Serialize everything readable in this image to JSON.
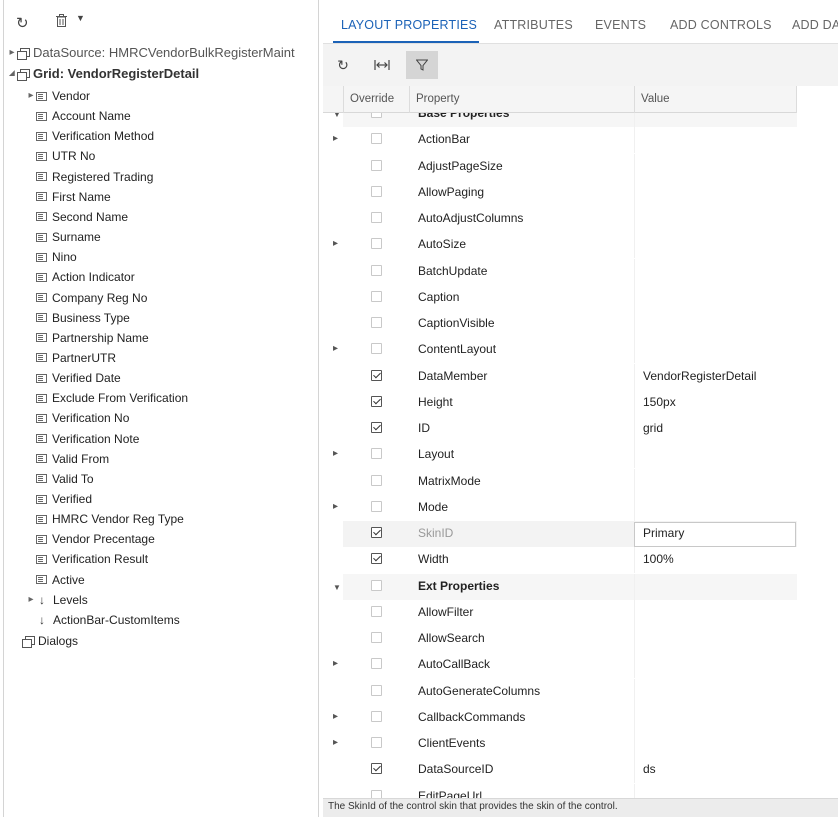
{
  "left_panel": {
    "toolbar": {
      "refresh_icon": "refresh-icon",
      "delete_icon": "trash-icon",
      "dropdown_icon": "caret-down-icon"
    },
    "datasource_label": "DataSource: HMRCVendorBulkRegisterMaint",
    "grid_label": "Grid: VendorRegisterDetail",
    "fields": [
      "Vendor",
      "Account Name",
      "Verification Method",
      "UTR No",
      "Registered Trading",
      "First Name",
      "Second Name",
      "Surname",
      "Nino",
      "Action Indicator",
      "Company Reg No",
      "Business Type",
      "Partnership Name",
      "PartnerUTR",
      "Verified Date",
      "Exclude From Verification",
      "Verification No",
      "Verification Note",
      "Valid From",
      "Valid To",
      "Verified",
      "HMRC Vendor Reg Type",
      "Vendor Precentage",
      "Verification Result",
      "Active"
    ],
    "levels_label": "Levels",
    "actionbar_label": "ActionBar-CustomItems",
    "dialogs_label": "Dialogs"
  },
  "tabs": [
    "LAYOUT PROPERTIES",
    "ATTRIBUTES",
    "EVENTS",
    "ADD CONTROLS",
    "ADD DAT"
  ],
  "toolbar": {
    "refresh_icon": "refresh-icon",
    "fit_icon": "fit-columns-icon",
    "filter_icon": "filter-icon"
  },
  "grid": {
    "headers": {
      "override": "Override",
      "property": "Property",
      "value": "Value"
    },
    "rows": [
      {
        "prop": "Base Properties",
        "group": true,
        "expand": "open",
        "checked": false,
        "value": ""
      },
      {
        "prop": "ActionBar",
        "expand": "closed",
        "checked": false,
        "value": ""
      },
      {
        "prop": "AdjustPageSize",
        "checked": false,
        "value": ""
      },
      {
        "prop": "AllowPaging",
        "checked": false,
        "value": ""
      },
      {
        "prop": "AutoAdjustColumns",
        "checked": false,
        "value": ""
      },
      {
        "prop": "AutoSize",
        "expand": "closed",
        "checked": false,
        "value": ""
      },
      {
        "prop": "BatchUpdate",
        "checked": false,
        "value": ""
      },
      {
        "prop": "Caption",
        "checked": false,
        "value": ""
      },
      {
        "prop": "CaptionVisible",
        "checked": false,
        "value": ""
      },
      {
        "prop": "ContentLayout",
        "expand": "closed",
        "checked": false,
        "value": ""
      },
      {
        "prop": "DataMember",
        "checked": true,
        "value": "VendorRegisterDetail"
      },
      {
        "prop": "Height",
        "checked": true,
        "value": "150px"
      },
      {
        "prop": "ID",
        "checked": true,
        "value": "grid"
      },
      {
        "prop": "Layout",
        "expand": "closed",
        "checked": false,
        "value": ""
      },
      {
        "prop": "MatrixMode",
        "checked": false,
        "value": ""
      },
      {
        "prop": "Mode",
        "expand": "closed",
        "checked": false,
        "value": ""
      },
      {
        "prop": "SkinID",
        "checked": true,
        "value": "Primary",
        "dim": true,
        "selected": true
      },
      {
        "prop": "Width",
        "checked": true,
        "value": "100%"
      },
      {
        "prop": "Ext Properties",
        "group": true,
        "expand": "open",
        "checked": false,
        "value": ""
      },
      {
        "prop": "AllowFilter",
        "checked": false,
        "value": ""
      },
      {
        "prop": "AllowSearch",
        "checked": false,
        "value": ""
      },
      {
        "prop": "AutoCallBack",
        "expand": "closed",
        "checked": false,
        "value": ""
      },
      {
        "prop": "AutoGenerateColumns",
        "checked": false,
        "value": ""
      },
      {
        "prop": "CallbackCommands",
        "expand": "closed",
        "checked": false,
        "value": ""
      },
      {
        "prop": "ClientEvents",
        "expand": "closed",
        "checked": false,
        "value": ""
      },
      {
        "prop": "DataSourceID",
        "checked": true,
        "value": "ds"
      },
      {
        "prop": "EditPageUrl",
        "checked": false,
        "value": ""
      }
    ]
  },
  "status_text": "The SkinId of the control skin that provides the skin of the control."
}
